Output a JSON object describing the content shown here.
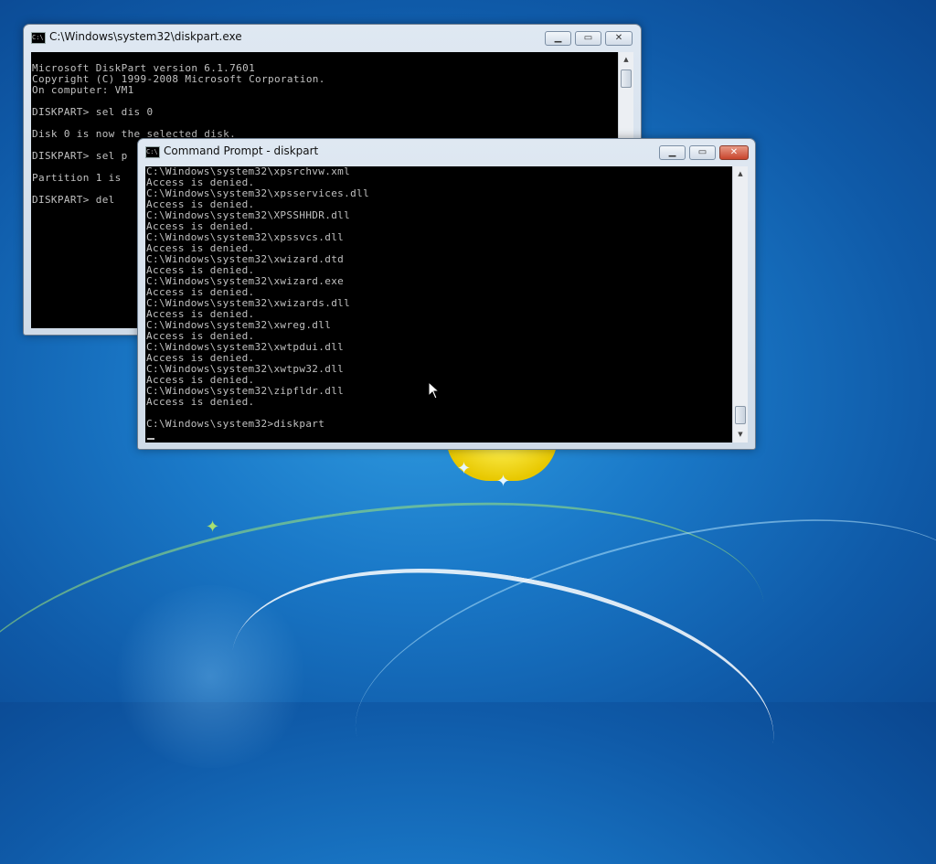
{
  "desktop": {
    "theme": "Windows 7 default"
  },
  "back_window": {
    "title": "C:\\Windows\\system32\\diskpart.exe",
    "lines": [
      "Microsoft DiskPart version 6.1.7601",
      "Copyright (C) 1999-2008 Microsoft Corporation.",
      "On computer: VM1",
      "",
      "DISKPART> sel dis 0",
      "",
      "Disk 0 is now the selected disk.",
      "",
      "DISKPART> sel p",
      "",
      "Partition 1 is",
      "",
      "DISKPART> del"
    ]
  },
  "front_window": {
    "title": "Command Prompt - diskpart",
    "icon": "cmd-icon",
    "lines": [
      "C:\\Windows\\system32\\xpsrchvw.xml",
      "Access is denied.",
      "C:\\Windows\\system32\\xpsservices.dll",
      "Access is denied.",
      "C:\\Windows\\system32\\XPSSHHDR.dll",
      "Access is denied.",
      "C:\\Windows\\system32\\xpssvcs.dll",
      "Access is denied.",
      "C:\\Windows\\system32\\xwizard.dtd",
      "Access is denied.",
      "C:\\Windows\\system32\\xwizard.exe",
      "Access is denied.",
      "C:\\Windows\\system32\\xwizards.dll",
      "Access is denied.",
      "C:\\Windows\\system32\\xwreg.dll",
      "Access is denied.",
      "C:\\Windows\\system32\\xwtpdui.dll",
      "Access is denied.",
      "C:\\Windows\\system32\\xwtpw32.dll",
      "Access is denied.",
      "C:\\Windows\\system32\\zipfldr.dll",
      "Access is denied.",
      "",
      "C:\\Windows\\system32>diskpart"
    ]
  },
  "controls": {
    "minimize": "▁",
    "maximize": "▭",
    "close": "✕"
  },
  "scroll_arrows": {
    "up": "▲",
    "down": "▼"
  },
  "colors": {
    "console_bg": "#000000",
    "console_text": "#c0c0c0",
    "close_active": "#c8452c"
  }
}
